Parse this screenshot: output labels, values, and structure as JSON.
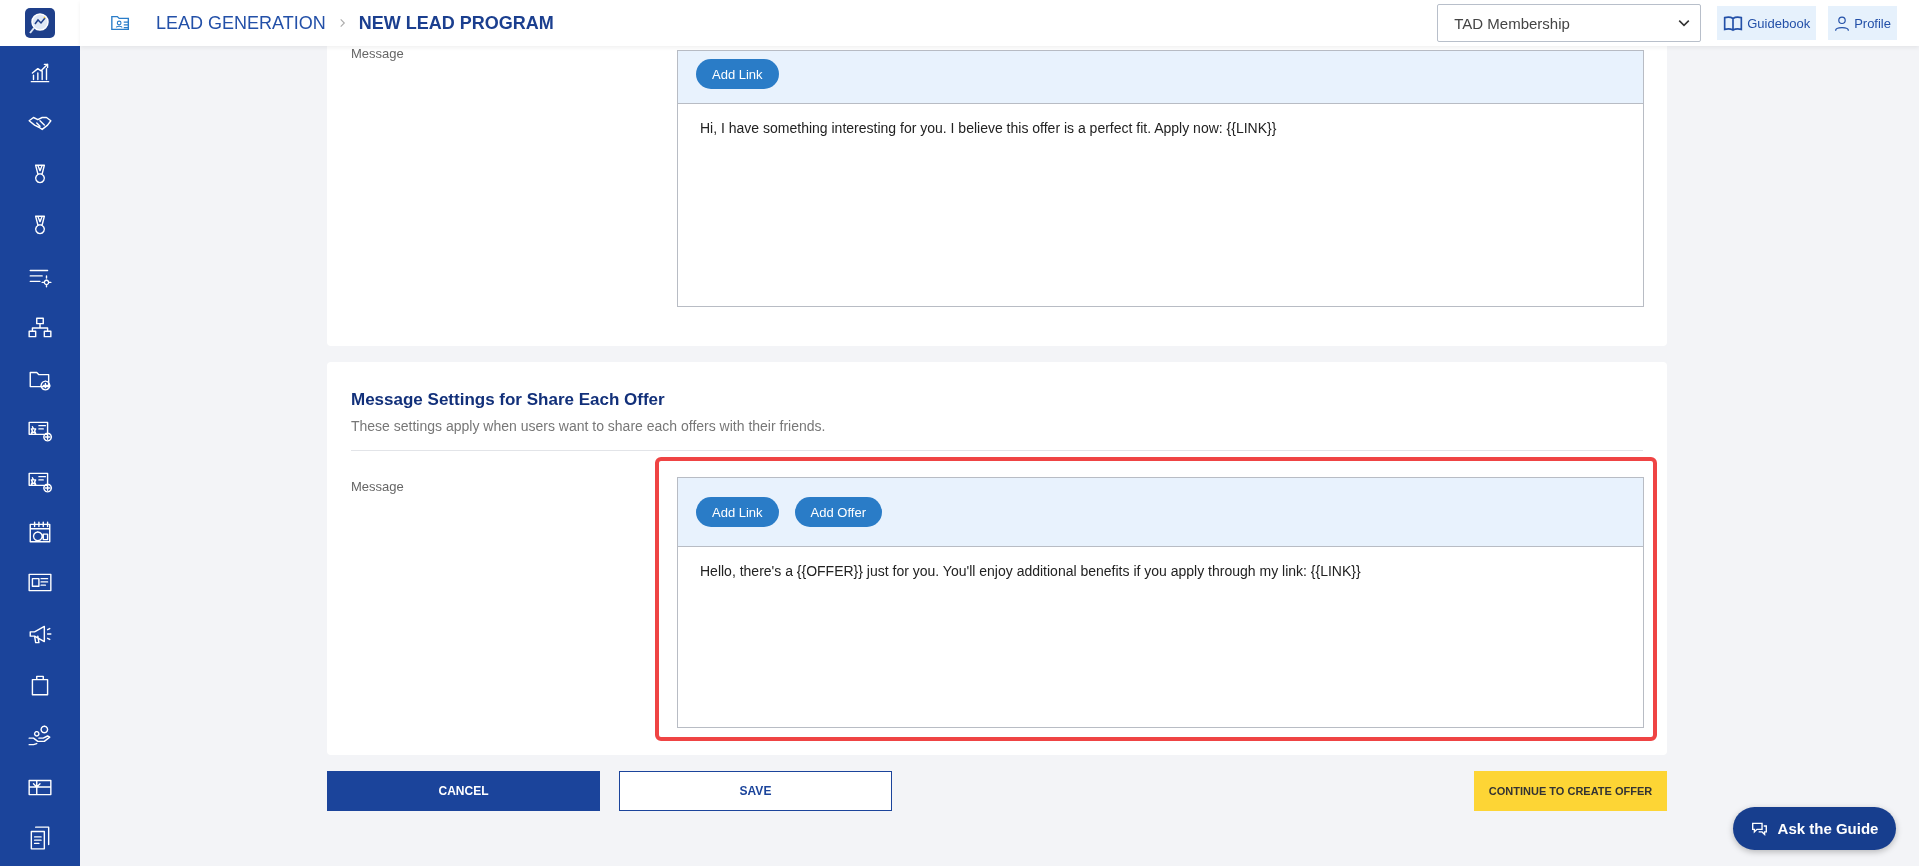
{
  "header": {
    "breadcrumb": [
      {
        "label": "LEAD GENERATION",
        "current": false
      },
      {
        "label": "NEW LEAD PROGRAM",
        "current": true
      }
    ],
    "program_select": {
      "value": "TAD Membership"
    },
    "buttons": [
      {
        "kind": "guidebook",
        "label": "Guidebook"
      },
      {
        "kind": "profile",
        "label": "Profile"
      }
    ]
  },
  "sections": [
    {
      "highlighted": false,
      "field_label": "Message",
      "editor_buttons": [
        "Add Link"
      ],
      "message": "Hi, I have something interesting for you. I believe this offer is a perfect fit. Apply now: {{LINK}}"
    },
    {
      "title": "Message Settings for Share Each Offer",
      "subtitle": "These settings apply when users want to share each offers with their friends.",
      "highlighted": true,
      "field_label": "Message",
      "editor_buttons": [
        "Add Link",
        "Add Offer"
      ],
      "message": "Hello, there's a {{OFFER}} just for you. You'll enjoy additional benefits if you apply through my link: {{LINK}}"
    }
  ],
  "actions": [
    {
      "kind": "primary",
      "label": "CANCEL"
    },
    {
      "kind": "outline",
      "label": "SAVE"
    },
    {
      "kind": "accent",
      "label": "CONTINUE TO CREATE OFFER"
    }
  ],
  "help_button": {
    "label": "Ask the Guide"
  }
}
